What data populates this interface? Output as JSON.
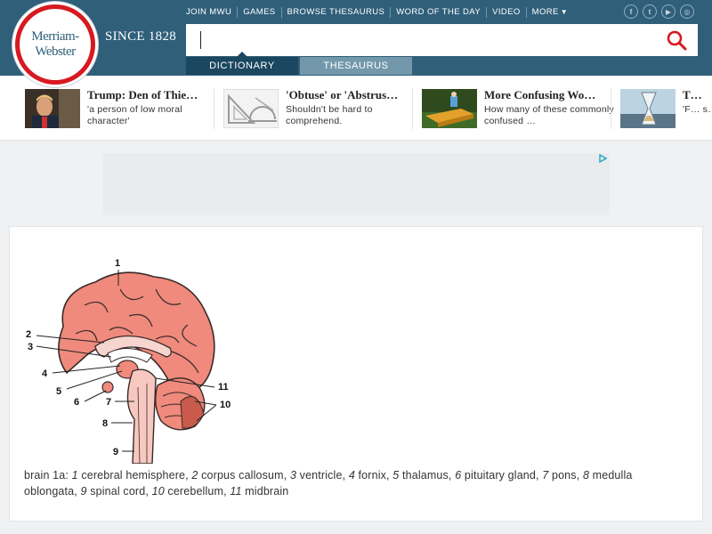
{
  "brand": {
    "logo_line1": "Merriam-",
    "logo_line2": "Webster",
    "since": "SINCE 1828",
    "accent": "#305f7a",
    "logo_red": "#d71920"
  },
  "topnav": {
    "items": [
      "JOIN MWU",
      "GAMES",
      "BROWSE THESAURUS",
      "WORD OF THE DAY",
      "VIDEO",
      "MORE"
    ],
    "social_icons": [
      "facebook-icon",
      "twitter-icon",
      "youtube-icon",
      "instagram-icon"
    ],
    "social_glyphs": [
      "f",
      "t",
      "▶",
      "◎"
    ]
  },
  "search": {
    "value": "",
    "placeholder": "",
    "icon": "search-icon"
  },
  "tabs": {
    "dictionary": "DICTIONARY",
    "thesaurus": "THESAURUS",
    "active": "dictionary"
  },
  "trending": [
    {
      "title": "Trump: Den of Thie…",
      "desc": "'a person of low moral character'"
    },
    {
      "title": "'Obtuse' or 'Abstrus…",
      "desc": "Shouldn't be hard to comprehend."
    },
    {
      "title": "More Confusing Wo…",
      "desc": "How many of these commonly confused …"
    },
    {
      "title": "T…",
      "desc": "'F… s…"
    }
  ],
  "illustration": {
    "labels": [
      "1",
      "2",
      "3",
      "4",
      "5",
      "6",
      "7",
      "8",
      "9",
      "10",
      "11"
    ]
  },
  "caption": {
    "lead": "brain 1a: ",
    "parts": [
      {
        "n": "1",
        "t": " cerebral hemisphere, "
      },
      {
        "n": "2",
        "t": " corpus callosum, "
      },
      {
        "n": "3",
        "t": " ventricle, "
      },
      {
        "n": "4",
        "t": " fornix, "
      },
      {
        "n": "5",
        "t": " thalamus, "
      },
      {
        "n": "6",
        "t": " pituitary gland, "
      },
      {
        "n": "7",
        "t": " pons, "
      },
      {
        "n": "8",
        "t": " medulla oblongata, "
      },
      {
        "n": "9",
        "t": " spinal cord, "
      },
      {
        "n": "10",
        "t": " cerebellum, "
      },
      {
        "n": "11",
        "t": " midbrain"
      }
    ]
  }
}
